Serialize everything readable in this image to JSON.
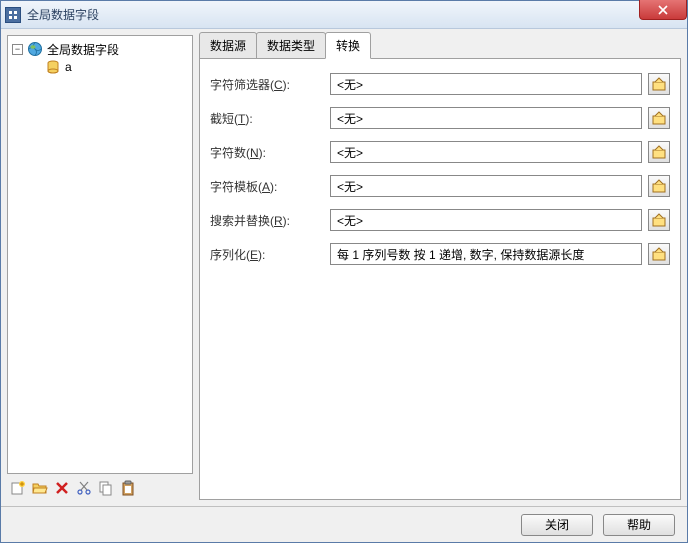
{
  "window": {
    "title": "全局数据字段"
  },
  "tree": {
    "root_label": "全局数据字段",
    "child_label": "a"
  },
  "tabs": {
    "t0": "数据源",
    "t1": "数据类型",
    "t2": "转换"
  },
  "form": {
    "char_filter": {
      "label_pre": "字符筛选器(",
      "mnemonic": "C",
      "label_post": "):",
      "value": "<无>"
    },
    "truncate": {
      "label_pre": "截短(",
      "mnemonic": "T",
      "label_post": "):",
      "value": "<无>"
    },
    "char_count": {
      "label_pre": "字符数(",
      "mnemonic": "N",
      "label_post": "):",
      "value": "<无>"
    },
    "char_tpl": {
      "label_pre": "字符模板(",
      "mnemonic": "A",
      "label_post": "):",
      "value": "<无>"
    },
    "search_repl": {
      "label_pre": "搜索并替换(",
      "mnemonic": "R",
      "label_post": "):",
      "value": "<无>"
    },
    "serialize": {
      "label_pre": "序列化(",
      "mnemonic": "E",
      "label_post": "):",
      "value": "每 1 序列号数 按 1 递增, 数字, 保持数据源长度"
    }
  },
  "buttons": {
    "close": "关闭",
    "help": "帮助"
  }
}
